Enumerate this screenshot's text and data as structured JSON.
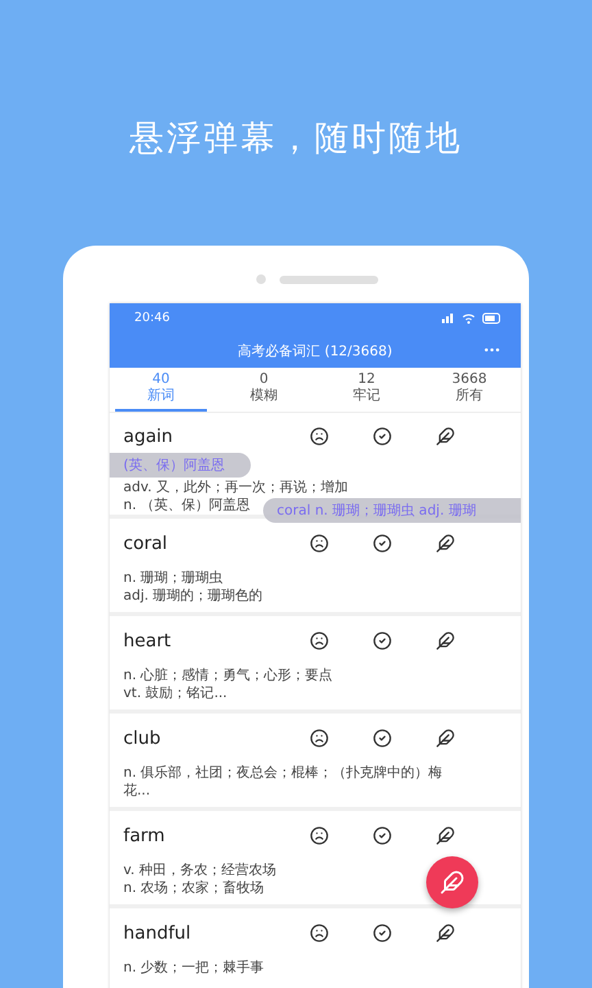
{
  "headline": "悬浮弹幕，随时随地",
  "status_bar": {
    "time": "20:46"
  },
  "header": {
    "title": "高考必备词汇 (12/3668)"
  },
  "tabs": [
    {
      "count": "40",
      "label": "新词",
      "selected": true
    },
    {
      "count": "0",
      "label": "模糊",
      "selected": false
    },
    {
      "count": "12",
      "label": "牢记",
      "selected": false
    },
    {
      "count": "3668",
      "label": "所有",
      "selected": false
    }
  ],
  "words": [
    {
      "word": "again",
      "definitions": [
        "adv. 又，此外；再一次；再说；增加",
        "n. （英、保）阿盖恩"
      ]
    },
    {
      "word": "coral",
      "definitions": [
        "n. 珊瑚；珊瑚虫",
        "adj. 珊瑚的；珊瑚色的"
      ]
    },
    {
      "word": "heart",
      "definitions": [
        "n. 心脏；感情；勇气；心形；要点",
        "vt. 鼓励；铭记..."
      ]
    },
    {
      "word": "club",
      "definitions": [
        "n. 俱乐部，社团；夜总会；棍棒；（扑克牌中的）梅花..."
      ]
    },
    {
      "word": "farm",
      "definitions": [
        "v. 种田，务农；经营农场",
        "n. 农场；农家；畜牧场"
      ]
    },
    {
      "word": "handful",
      "definitions": [
        "n. 少数；一把；棘手事"
      ]
    }
  ],
  "danmaku": [
    {
      "text": "(英、保）阿盖恩"
    },
    {
      "text": "coral n. 珊瑚；珊瑚虫 adj. 珊瑚"
    }
  ]
}
